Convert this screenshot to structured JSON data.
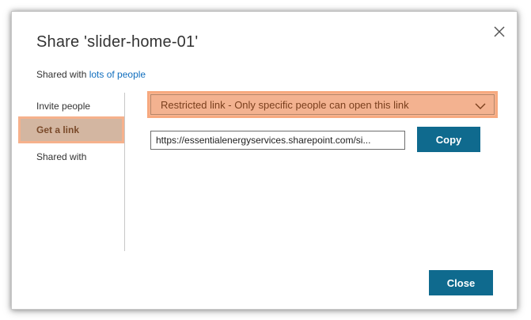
{
  "dialog": {
    "title": "Share 'slider-home-01'",
    "shared_with_prefix": "Shared with ",
    "shared_with_link": "lots of people"
  },
  "nav": {
    "items": [
      {
        "label": "Invite people",
        "selected": false
      },
      {
        "label": "Get a link",
        "selected": true
      },
      {
        "label": "Shared with",
        "selected": false
      }
    ]
  },
  "link": {
    "dropdown_value": "Restricted link - Only specific people can open this link",
    "url": "https://essentialenergyservices.sharepoint.com/si...",
    "copy_label": "Copy"
  },
  "footer": {
    "close_label": "Close"
  },
  "icons": {
    "close": "close-icon",
    "dropdown": "chevron-down-icon"
  },
  "colors": {
    "primary_button": "#0f6a8e",
    "link_text": "#106ebe",
    "highlight": "#f6b18c"
  }
}
